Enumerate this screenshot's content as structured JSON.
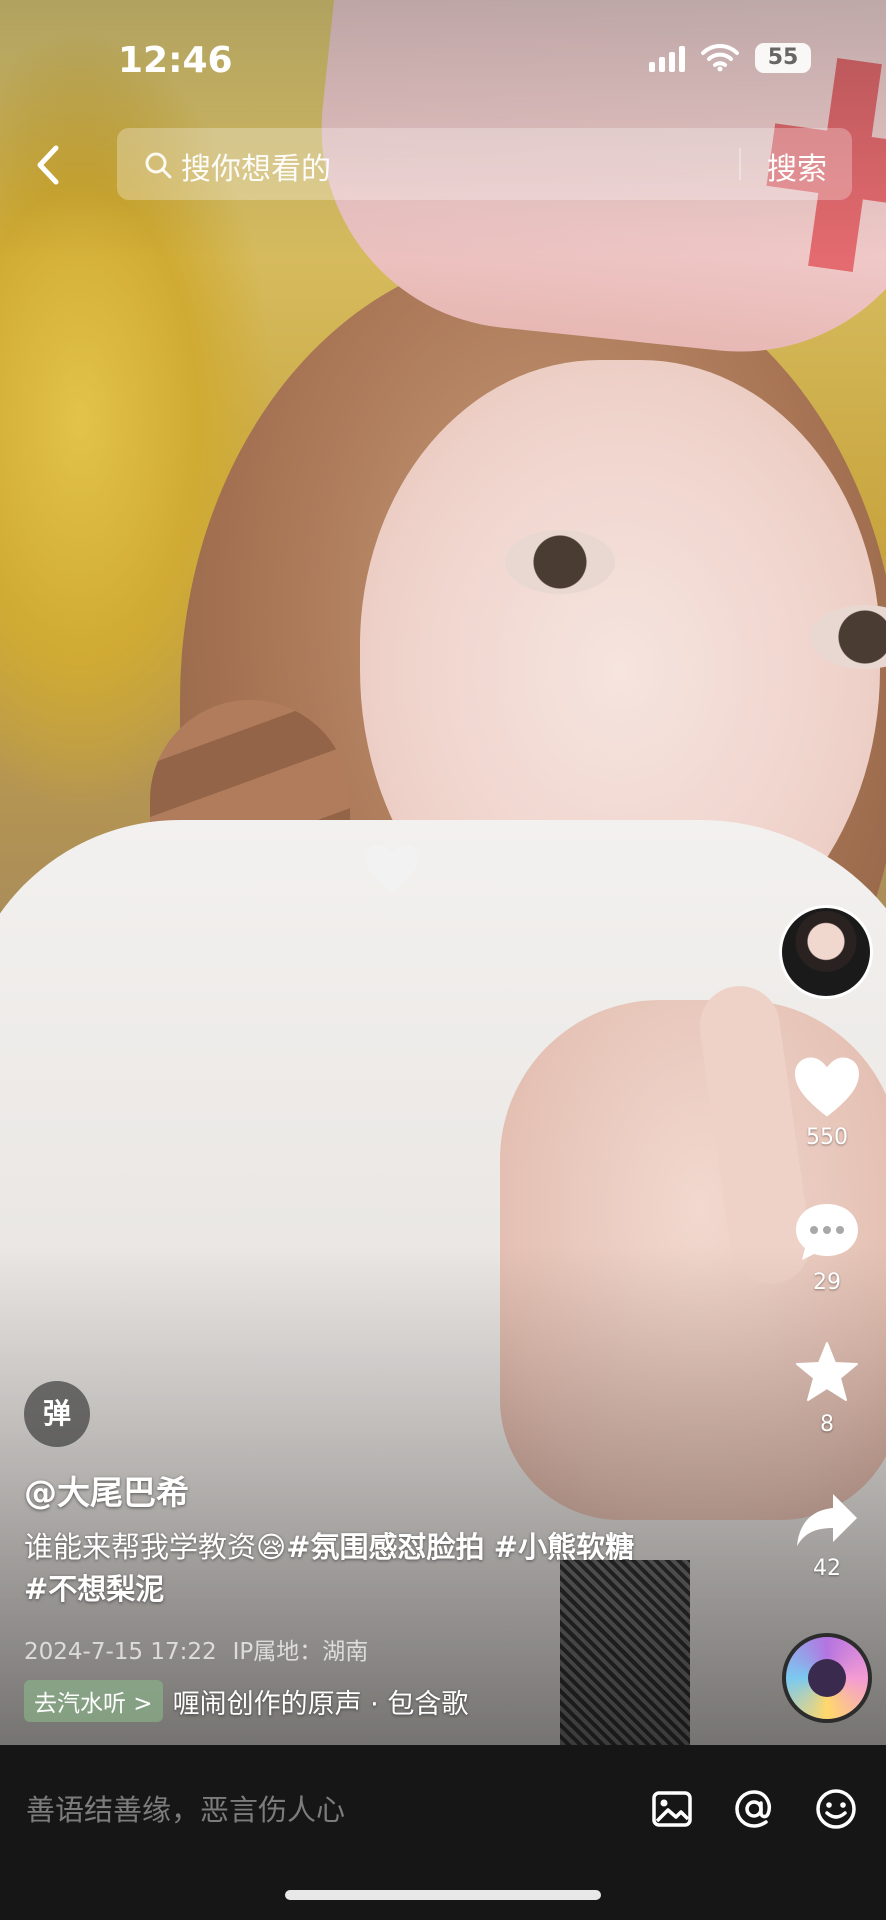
{
  "status_bar": {
    "time": "12:46",
    "battery": "55"
  },
  "search": {
    "placeholder": "搜你想看的",
    "submit_label": "搜索"
  },
  "right_rail": {
    "like_count": "550",
    "comment_count": "29",
    "favorite_count": "8",
    "share_count": "42"
  },
  "post": {
    "danmaku_label": "弹",
    "author": "@大尾巴希",
    "caption_text": "谁能来帮我学教资",
    "caption_emoji": "😪",
    "tags": [
      "#氛围感怼脸拍",
      "#小熊软糖",
      "#不想梨泥"
    ],
    "date": "2024-7-15 17:22",
    "ip_location": "IP属地：湖南",
    "music_chip": "去汽水听 >",
    "music_text": "喱闹创作的原声 · 包含歌"
  },
  "comment_bar": {
    "placeholder": "善语结善缘，恶言伤人心"
  }
}
